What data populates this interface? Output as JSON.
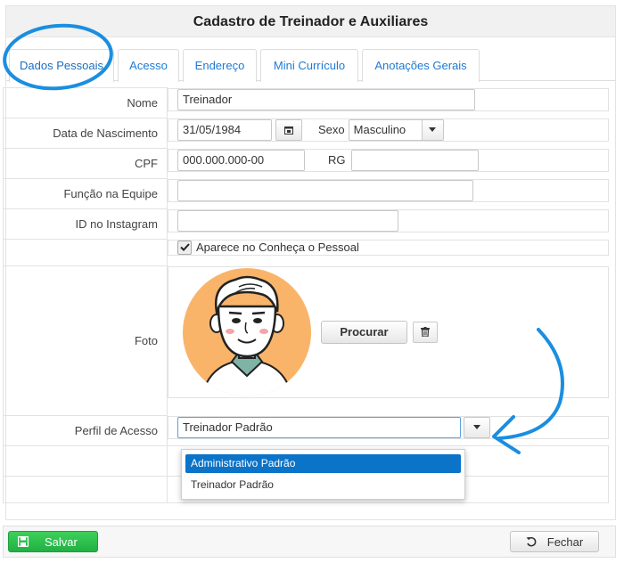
{
  "window": {
    "title": "Cadastro de Treinador e Auxiliares"
  },
  "tabs": [
    {
      "label": "Dados Pessoais",
      "active": true
    },
    {
      "label": "Acesso"
    },
    {
      "label": "Endereço"
    },
    {
      "label": "Mini Currículo"
    },
    {
      "label": "Anotações Gerais"
    }
  ],
  "form": {
    "nome": {
      "label": "Nome",
      "value": "Treinador"
    },
    "nascimento": {
      "label": "Data de Nascimento",
      "value": "31/05/1984"
    },
    "sexo": {
      "label": "Sexo",
      "value": "Masculino"
    },
    "cpf": {
      "label": "CPF",
      "value": "000.000.000-00"
    },
    "rg": {
      "label": "RG",
      "value": ""
    },
    "funcao": {
      "label": "Função na Equipe",
      "value": ""
    },
    "instagram": {
      "label": "ID no Instagram",
      "value": ""
    },
    "aparece": {
      "label": "Aparece no Conheça o Pessoal",
      "checked": true
    },
    "foto": {
      "label": "Foto",
      "browse_label": "Procurar"
    },
    "perfil": {
      "label": "Perfil de Acesso",
      "value": "Treinador Padrão",
      "options": [
        "Administrativo Padrão",
        "Treinador Padrão"
      ],
      "highlighted": "Administrativo Padrão"
    }
  },
  "footer": {
    "save_label": "Salvar",
    "close_label": "Fechar"
  },
  "colors": {
    "accent": "#1d7bd4",
    "save": "#28b446",
    "highlight": "#0b73c8",
    "annotation": "#1a8ee0",
    "avatar_bg": "#f9b46a"
  }
}
